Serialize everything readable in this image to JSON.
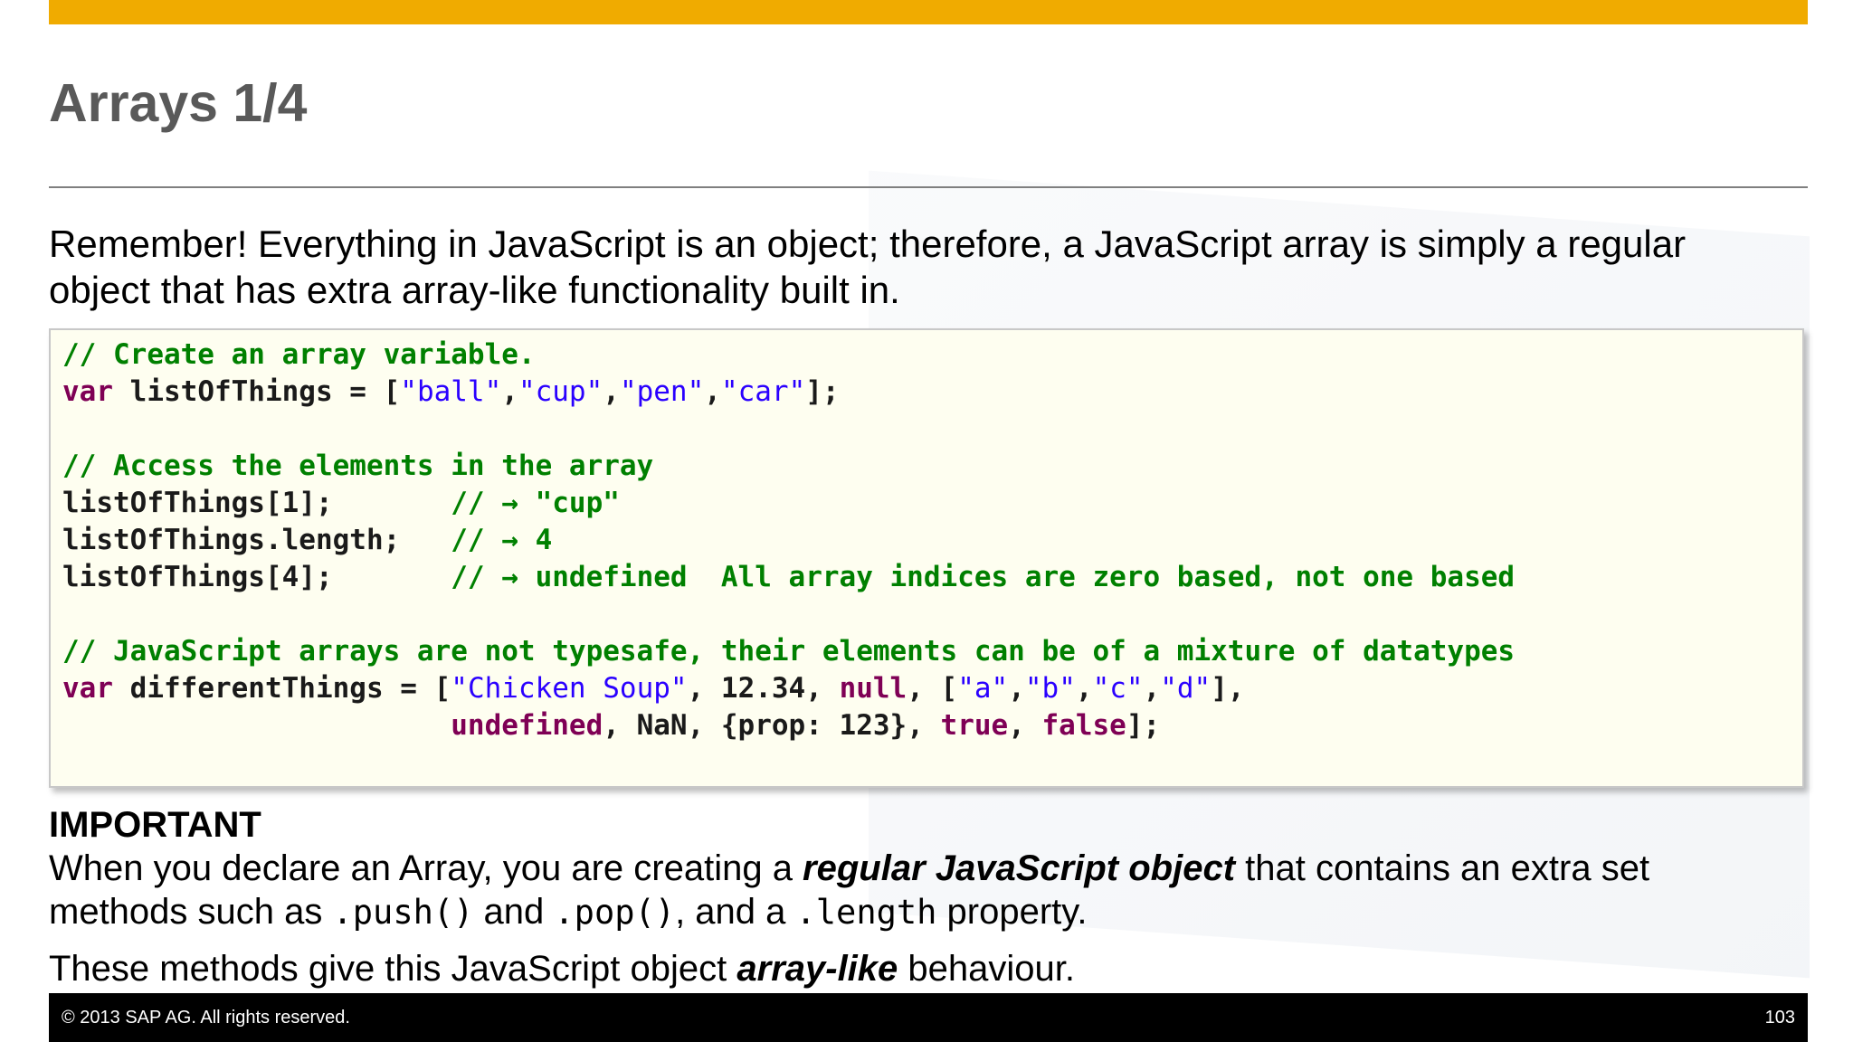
{
  "slide": {
    "title": "Arrays 1/4",
    "intro": "Remember!  Everything in JavaScript is an object; therefore, a JavaScript array is simply a regular object that has extra array-like functionality built in."
  },
  "code": {
    "l1_comment": "// Create an array variable.",
    "l2_kw": "var",
    "l2_text": " listOfThings = [",
    "l2_s1": "\"ball\"",
    "l2_s2": "\"cup\"",
    "l2_s3": "\"pen\"",
    "l2_s4": "\"car\"",
    "l2_end": "];",
    "l3_blank": " ",
    "l4_comment": "// Access the elements in the array",
    "l5_text": "listOfThings[1];       ",
    "l5_comment": "// → \"cup\"",
    "l6_text": "listOfThings.length;   ",
    "l6_comment": "// → 4",
    "l7_text": "listOfThings[4];       ",
    "l7_comment": "// → undefined  All array indices are zero based, not one based",
    "l8_blank": " ",
    "l9_comment": "// JavaScript arrays are not typesafe, their elements can be of a mixture of datatypes",
    "l10_kw": "var",
    "l10_text": " differentThings = [",
    "l10_s1": "\"Chicken Soup\"",
    "l10_mid": ", 12.34, ",
    "l10_null": "null",
    "l10_arr_open": ", [",
    "l10_sa": "\"a\"",
    "l10_sb": "\"b\"",
    "l10_sc": "\"c\"",
    "l10_sd": "\"d\"",
    "l10_end": "],",
    "l11_indent": "                       ",
    "l11_undef": "undefined",
    "l11_mid": ", NaN, {prop: 123}, ",
    "l11_true": "true",
    "l11_comma": ", ",
    "l11_false": "false",
    "l11_end": "];"
  },
  "important": {
    "heading": "IMPORTANT",
    "p1_a": "When you declare an Array, you are creating a ",
    "p1_bold": "regular JavaScript object",
    "p1_b": " that contains an extra set methods such as ",
    "p1_push": ".push()",
    "p1_and": " and ",
    "p1_pop": ".pop()",
    "p1_c": ", and a ",
    "p1_length": ".length",
    "p1_d": " property.",
    "p2_a": "These methods give this JavaScript object ",
    "p2_bold": "array-like",
    "p2_b": "  behaviour."
  },
  "footer": {
    "copyright": "©  2013 SAP AG. All rights reserved.",
    "page_number": "103"
  },
  "colors": {
    "accent_bar": "#f0ab00",
    "title": "#595959",
    "code_bg": "#fefef0",
    "code_comment": "#008000",
    "code_keyword": "#7f0055",
    "code_string": "#2a00ff"
  }
}
